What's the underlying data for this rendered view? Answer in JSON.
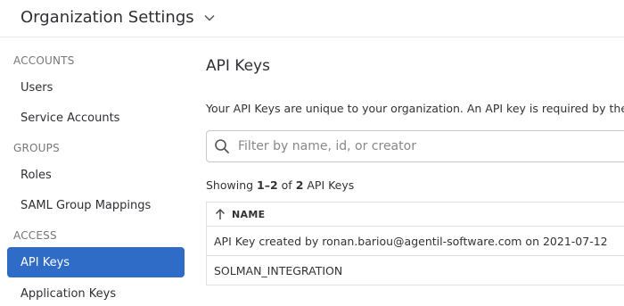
{
  "header": {
    "title": "Organization Settings"
  },
  "sidebar": {
    "sections": [
      {
        "label": "ACCOUNTS",
        "items": [
          {
            "label": "Users"
          },
          {
            "label": "Service Accounts"
          }
        ]
      },
      {
        "label": "GROUPS",
        "items": [
          {
            "label": "Roles"
          },
          {
            "label": "SAML Group Mappings"
          }
        ]
      },
      {
        "label": "ACCESS",
        "items": [
          {
            "label": "API Keys",
            "active": true
          },
          {
            "label": "Application Keys"
          }
        ]
      }
    ]
  },
  "main": {
    "title": "API Keys",
    "description": "Your API Keys are unique to your organization. An API key is required by the D",
    "search": {
      "placeholder": "Filter by name, id, or creator",
      "value": ""
    },
    "showing": {
      "prefix": "Showing ",
      "range": "1–2",
      "middle": " of ",
      "total": "2",
      "suffix": " API Keys"
    },
    "table": {
      "columns": [
        {
          "label": "NAME",
          "sort": "ascending"
        }
      ],
      "rows": [
        {
          "name": "API Key created by ronan.bariou@agentil-software.com on 2021-07-12"
        },
        {
          "name": "SOLMAN_INTEGRATION"
        }
      ]
    }
  },
  "colors": {
    "accent": "#2e6cc7",
    "border": "#e2e2e2"
  }
}
